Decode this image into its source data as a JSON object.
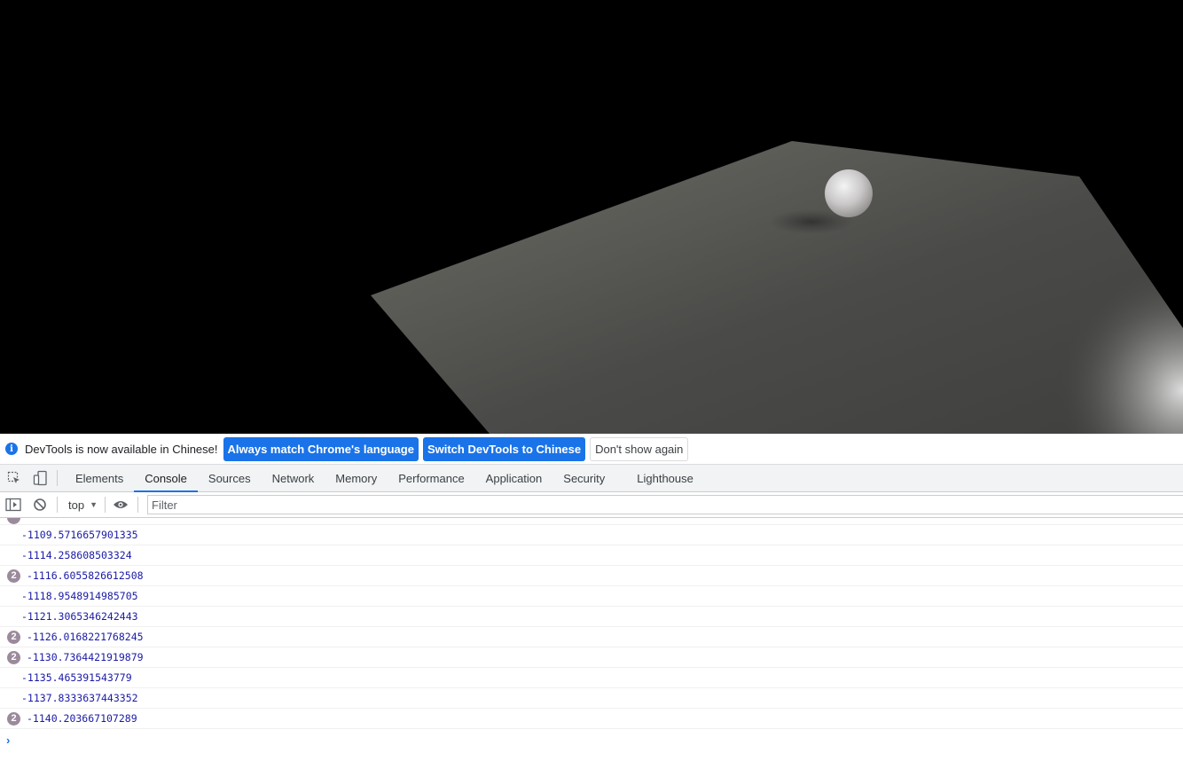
{
  "infobar": {
    "message": "DevTools is now available in Chinese!",
    "buttons": {
      "match_language": "Always match Chrome's language",
      "switch_language": "Switch DevTools to Chinese",
      "dont_show": "Don't show again"
    }
  },
  "tabs": [
    {
      "label": "Elements"
    },
    {
      "label": "Console",
      "active": true
    },
    {
      "label": "Sources"
    },
    {
      "label": "Network"
    },
    {
      "label": "Memory"
    },
    {
      "label": "Performance"
    },
    {
      "label": "Application"
    },
    {
      "label": "Security"
    },
    {
      "label": "Lighthouse"
    }
  ],
  "console_toolbar": {
    "context": "top",
    "filter_placeholder": "Filter"
  },
  "messages": [
    {
      "value": "-1109.5716657901335",
      "count": ""
    },
    {
      "value": "-1114.258608503324",
      "count": ""
    },
    {
      "value": "-1116.6055826612508",
      "count": "2"
    },
    {
      "value": "-1118.9548914985705",
      "count": ""
    },
    {
      "value": "-1121.3065346242443",
      "count": ""
    },
    {
      "value": "-1126.0168221768245",
      "count": "2"
    },
    {
      "value": "-1130.7364421919879",
      "count": "2"
    },
    {
      "value": "-1135.465391543779",
      "count": ""
    },
    {
      "value": "-1137.8333637443352",
      "count": ""
    },
    {
      "value": "-1140.203667107289",
      "count": "2"
    }
  ],
  "prompt_symbol": "›",
  "colors": {
    "accent": "#1a73e8",
    "badge": "#9b8a9c",
    "number": "#1a1aa6",
    "plane": "#5a5a55"
  },
  "icons": {
    "info": "info-icon",
    "inspect": "inspect-element-icon",
    "device": "device-toolbar-icon",
    "sidebar": "sidebar-toggle-icon",
    "clear": "clear-console-icon",
    "eye": "live-expression-icon"
  }
}
